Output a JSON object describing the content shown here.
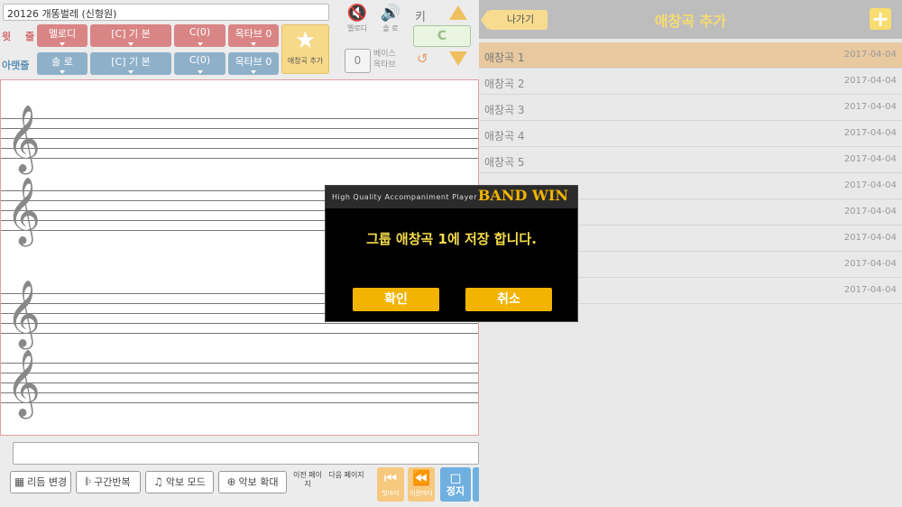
{
  "header": {
    "song_title": "20126 개똥벌레 (신형원)",
    "top_row_label": "윗 줄",
    "bottom_row_label": "아랫줄",
    "top_row": [
      "멜로디",
      "[C] 기 본",
      "C(0)",
      "옥타브 0"
    ],
    "bottom_row": [
      "솔 로",
      "[C] 기 본",
      "C(0)",
      "옥타브 0"
    ],
    "favorite_label": "애창곡 추가",
    "melody_label": "멜로디",
    "solo_label": "솔 로",
    "key_label": "키",
    "key_value": "C",
    "bass_octave_value": "0",
    "bass_octave_label": "베이스 옥타브"
  },
  "toolbar": {
    "rhythm_change": "리듬 변경",
    "section_repeat": "구간반복",
    "score_mode": "악보 모드",
    "score_zoom": "악보 확대",
    "prev_page": "이전 페이지",
    "next_page": "다음 페이지",
    "first_measure": "첫마디",
    "prev_measure": "이전마디",
    "stop": "정지"
  },
  "panel": {
    "back_label": "나가기",
    "title": "애창곡 추가",
    "add_label": "+",
    "items": [
      {
        "name": "애창곡 1",
        "date": "2017-04-04"
      },
      {
        "name": "애창곡 2",
        "date": "2017-04-04"
      },
      {
        "name": "애창곡 3",
        "date": "2017-04-04"
      },
      {
        "name": "애창곡 4",
        "date": "2017-04-04"
      },
      {
        "name": "애창곡 5",
        "date": "2017-04-04"
      },
      {
        "name": "",
        "date": "2017-04-04"
      },
      {
        "name": "",
        "date": "2017-04-04"
      },
      {
        "name": "",
        "date": "2017-04-04"
      },
      {
        "name": "",
        "date": "2017-04-04"
      },
      {
        "name": "",
        "date": "2017-04-04"
      }
    ]
  },
  "dialog": {
    "subtitle": "High Quality Accompaniment Player",
    "brand": "BAND WIN",
    "message": "그룹 애창곡 1에 저장 합니다.",
    "ok": "확인",
    "cancel": "취소"
  },
  "colors": {
    "accent_yellow": "#f2b400",
    "top_row": "#d98585",
    "bottom_row": "#8fb0c9",
    "selected_item": "#e8c9a0"
  }
}
